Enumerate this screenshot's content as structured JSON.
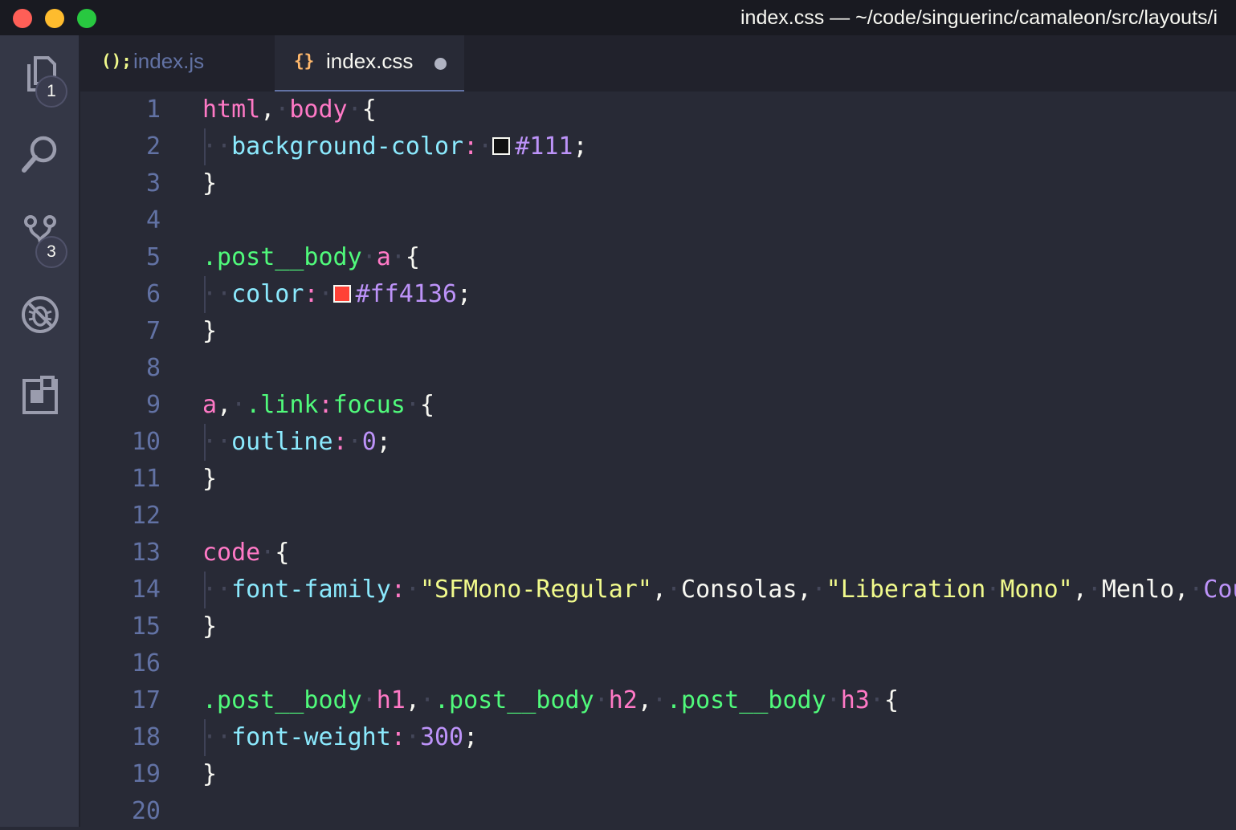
{
  "window": {
    "title": "index.css — ~/code/singuerinc/camaleon/src/layouts/i",
    "traffic_lights": {
      "close": "#ff5f57",
      "minimize": "#febc2e",
      "zoom": "#28c840"
    }
  },
  "activity_bar": {
    "items": [
      {
        "icon": "explorer-icon",
        "badge": "1"
      },
      {
        "icon": "search-icon"
      },
      {
        "icon": "source-control-icon",
        "badge": "3"
      },
      {
        "icon": "debug-icon"
      },
      {
        "icon": "extensions-icon"
      }
    ]
  },
  "tabs": [
    {
      "label": "index.js",
      "icon_text": "();",
      "active": false
    },
    {
      "label": "index.css",
      "icon_text": "{}",
      "active": true,
      "dirty": true
    }
  ],
  "editor": {
    "line_numbers": [
      "1",
      "2",
      "3",
      "4",
      "5",
      "6",
      "7",
      "8",
      "9",
      "10",
      "11",
      "12",
      "13",
      "14",
      "15",
      "16",
      "17",
      "18",
      "19",
      "20"
    ],
    "tokens": {
      "html": "html",
      "body": "body",
      "comma": ",",
      "open": "{",
      "close": "}",
      "background_color": "background-color",
      "colon": ":",
      "semi": ";",
      "swatch_111": "#111",
      "val_111": "#111",
      "post_body": ".post__body",
      "a": "a",
      "color": "color",
      "swatch_ff4136": "#ff4136",
      "val_ff4136": "#ff4136",
      "link": ".link",
      "focus": "focus",
      "outline": "outline",
      "zero": "0",
      "code": "code",
      "font_family": "font-family",
      "str_sfmono": "\"SFMono-Regular\"",
      "consolas": "Consolas",
      "str_liberation": "\"Liberation",
      "mono": "Mono\"",
      "menlo": "Menlo",
      "cou": "Cou",
      "h1": "h1",
      "h2": "h2",
      "h3": "h3",
      "font_weight": "font-weight",
      "w300": "300"
    }
  }
}
